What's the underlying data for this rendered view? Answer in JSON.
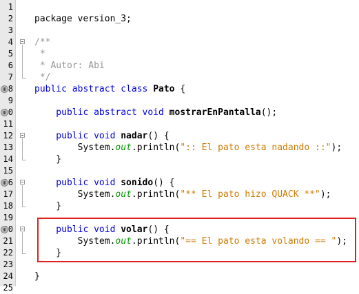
{
  "lines": [
    {
      "n": "1",
      "seg": []
    },
    {
      "n": "2",
      "seg": [
        {
          "t": "package version_3;",
          "c": "plain"
        }
      ]
    },
    {
      "n": "3",
      "seg": []
    },
    {
      "n": "4",
      "seg": [
        {
          "t": "/**",
          "c": "cmt"
        }
      ]
    },
    {
      "n": "5",
      "seg": [
        {
          "t": " *",
          "c": "cmt"
        }
      ]
    },
    {
      "n": "6",
      "seg": [
        {
          "t": " * Autor: Abi",
          "c": "cmt"
        }
      ]
    },
    {
      "n": "7",
      "seg": [
        {
          "t": " */",
          "c": "cmt"
        }
      ]
    },
    {
      "n": "8",
      "seg": [
        {
          "t": "public abstract class ",
          "c": "kw"
        },
        {
          "t": "Pato",
          "c": "bold"
        },
        {
          "t": " {",
          "c": "plain"
        }
      ]
    },
    {
      "n": "9",
      "seg": []
    },
    {
      "n": "10",
      "seg": [
        {
          "t": "    public abstract void ",
          "c": "kw"
        },
        {
          "t": "mostrarEnPantalla",
          "c": "bold"
        },
        {
          "t": "();",
          "c": "plain"
        }
      ]
    },
    {
      "n": "11",
      "seg": []
    },
    {
      "n": "12",
      "seg": [
        {
          "t": "    public void ",
          "c": "kw"
        },
        {
          "t": "nadar",
          "c": "bold"
        },
        {
          "t": "() {",
          "c": "plain"
        }
      ]
    },
    {
      "n": "13",
      "seg": [
        {
          "t": "        System.",
          "c": "plain"
        },
        {
          "t": "out",
          "c": "fld"
        },
        {
          "t": ".println(",
          "c": "plain"
        },
        {
          "t": "\":: El pato esta nadando ::\"",
          "c": "str"
        },
        {
          "t": ");",
          "c": "plain"
        }
      ]
    },
    {
      "n": "14",
      "seg": [
        {
          "t": "    }",
          "c": "plain"
        }
      ]
    },
    {
      "n": "15",
      "seg": []
    },
    {
      "n": "16",
      "seg": [
        {
          "t": "    public void ",
          "c": "kw"
        },
        {
          "t": "sonido",
          "c": "bold"
        },
        {
          "t": "() {",
          "c": "plain"
        }
      ]
    },
    {
      "n": "17",
      "seg": [
        {
          "t": "        System.",
          "c": "plain"
        },
        {
          "t": "out",
          "c": "fld"
        },
        {
          "t": ".println(",
          "c": "plain"
        },
        {
          "t": "\"** El pato hizo QUACK **\"",
          "c": "str"
        },
        {
          "t": ");",
          "c": "plain"
        }
      ]
    },
    {
      "n": "18",
      "seg": [
        {
          "t": "    }",
          "c": "plain"
        }
      ]
    },
    {
      "n": "19",
      "seg": []
    },
    {
      "n": "20",
      "seg": [
        {
          "t": "    public void ",
          "c": "kw"
        },
        {
          "t": "volar",
          "c": "bold"
        },
        {
          "t": "() {",
          "c": "plain"
        }
      ]
    },
    {
      "n": "21",
      "seg": [
        {
          "t": "        System.",
          "c": "plain"
        },
        {
          "t": "out",
          "c": "fld"
        },
        {
          "t": ".println(",
          "c": "plain"
        },
        {
          "t": "\"== El pato esta volando == \"",
          "c": "str"
        },
        {
          "t": ");",
          "c": "plain"
        }
      ]
    },
    {
      "n": "22",
      "seg": [
        {
          "t": "    }",
          "c": "plain"
        }
      ]
    },
    {
      "n": "23",
      "seg": []
    },
    {
      "n": "24",
      "seg": [
        {
          "t": "}",
          "c": "plain"
        }
      ]
    },
    {
      "n": "25",
      "seg": []
    }
  ],
  "annotated_lines": [
    "8",
    "10",
    "16",
    "20"
  ],
  "folded_start_lines": [
    "4",
    "12",
    "16",
    "20"
  ],
  "colors": {
    "keyword": "#0000e6",
    "string": "#ce7b00",
    "field": "#009900",
    "comment": "#969696",
    "highlight": "#e02020"
  }
}
